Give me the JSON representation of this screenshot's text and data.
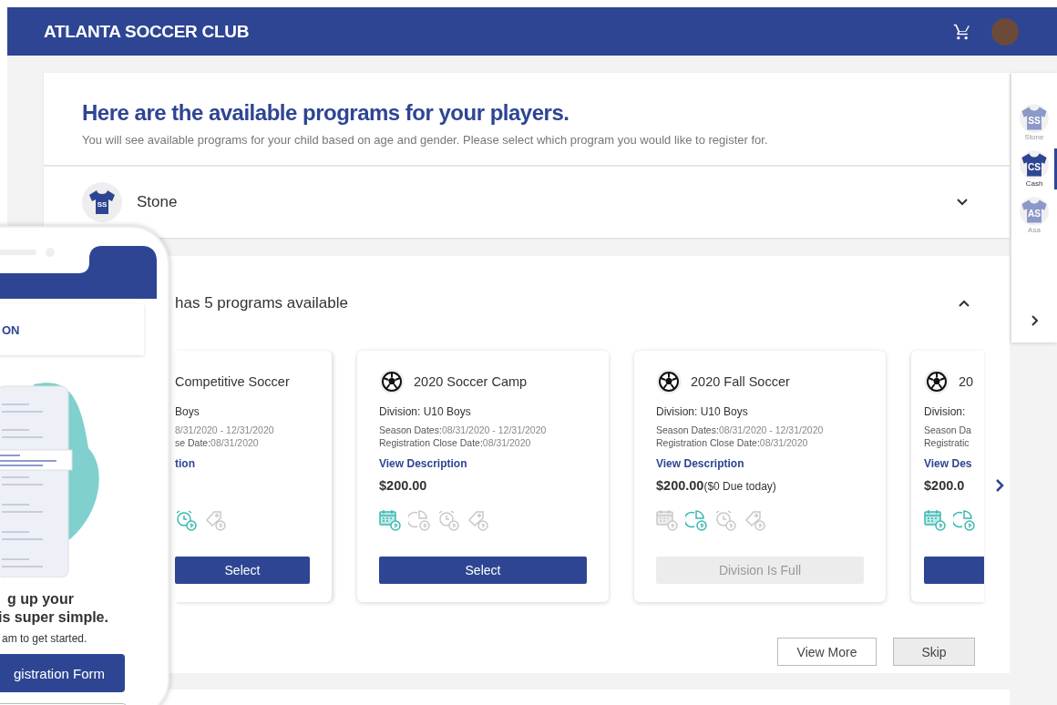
{
  "header": {
    "title": "ATLANTA SOCCER CLUB"
  },
  "intro": {
    "title": "Here are the available programs for your players.",
    "text": "You will see available programs for your child based on age and gender. Please select which program you would like to register for."
  },
  "player_row": {
    "initials": "SS",
    "name": "Stone",
    "expanded": false
  },
  "programs_section": {
    "title": "has 5 programs available",
    "expanded": true,
    "cards": [
      {
        "kind": "clip-left",
        "title": "Competitive Soccer",
        "division": "Boys",
        "season": "8/31/2020 - 12/31/2020",
        "close_label": "se Date:",
        "close": "08/31/2020",
        "link": "tion",
        "icons": [
          {
            "kind": "alarm",
            "active": true
          },
          {
            "kind": "tag",
            "active": false
          }
        ],
        "button": {
          "label": "Select",
          "disabled": false
        }
      },
      {
        "kind": "full",
        "title": "2020 Soccer Camp",
        "division": "Division: U10 Boys",
        "season_label": "Season Dates:",
        "season": "08/31/2020 - 12/31/2020",
        "close_label": "Registration Close Date:",
        "close": "08/31/2020",
        "link": "View Description",
        "price": "$200.00",
        "icons": [
          {
            "kind": "calendar",
            "active": true
          },
          {
            "kind": "pie",
            "active": false
          },
          {
            "kind": "alarm",
            "active": false
          },
          {
            "kind": "tag",
            "active": false
          }
        ],
        "button": {
          "label": "Select",
          "disabled": false
        }
      },
      {
        "kind": "full",
        "title": "2020 Fall Soccer",
        "division": "Division: U10 Boys",
        "season_label": "Season Dates:",
        "season": "08/31/2020 - 12/31/2020",
        "close_label": "Registration Close Date:",
        "close": "08/31/2020",
        "link": "View Description",
        "price": "$200.00",
        "due": "($0 Due today)",
        "icons": [
          {
            "kind": "calendar",
            "active": false
          },
          {
            "kind": "pie",
            "active": true
          },
          {
            "kind": "alarm",
            "active": false
          },
          {
            "kind": "tag",
            "active": false
          }
        ],
        "button": {
          "label": "Division Is Full",
          "disabled": true
        }
      },
      {
        "kind": "clip-right",
        "title": "20",
        "division": "Division:",
        "season_label": "Season Da",
        "close_label": "Registratic",
        "link": "View Des",
        "price": "$200.0",
        "icons": [
          {
            "kind": "calendar",
            "active": true
          },
          {
            "kind": "pie",
            "active": true
          }
        ],
        "button": {
          "disabled": false
        }
      }
    ],
    "actions": [
      {
        "label": "View More"
      },
      {
        "label": "Skip"
      }
    ]
  },
  "player_switcher": [
    {
      "initials": "SS",
      "name": "Stone",
      "selected": false
    },
    {
      "initials": "CS",
      "name": "Cash",
      "selected": true
    },
    {
      "initials": "AS",
      "name": "Asa",
      "selected": false
    }
  ],
  "phone": {
    "title": "ON",
    "heading_lines": [
      "g up your",
      "is super simple."
    ],
    "text": "am to get started.",
    "button": "gistration Form"
  }
}
